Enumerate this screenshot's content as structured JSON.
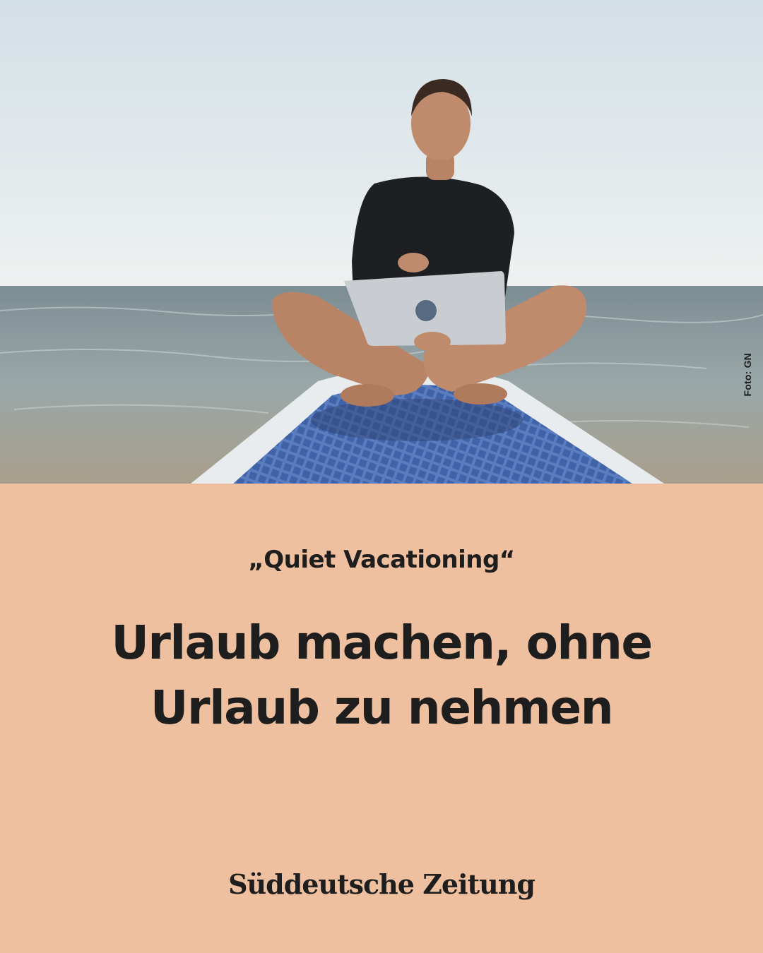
{
  "photo": {
    "credit": "Foto: GN",
    "colors": {
      "sky": "#dfe8ec",
      "sea": "#8f9ea3",
      "board": "#5b7fc0",
      "shirt": "#1d1f22",
      "laptop": "#c9cdd2",
      "skin": "#b98466"
    }
  },
  "article": {
    "kicker": "„Quiet Vacationing“",
    "headline": [
      "Urlaub machen, ohne",
      "Urlaub zu nehmen"
    ]
  },
  "brand": {
    "logo": "Süddeutsche Zeitung"
  },
  "colors": {
    "panel_bg": "#eec09f",
    "text": "#1e1e1e"
  }
}
